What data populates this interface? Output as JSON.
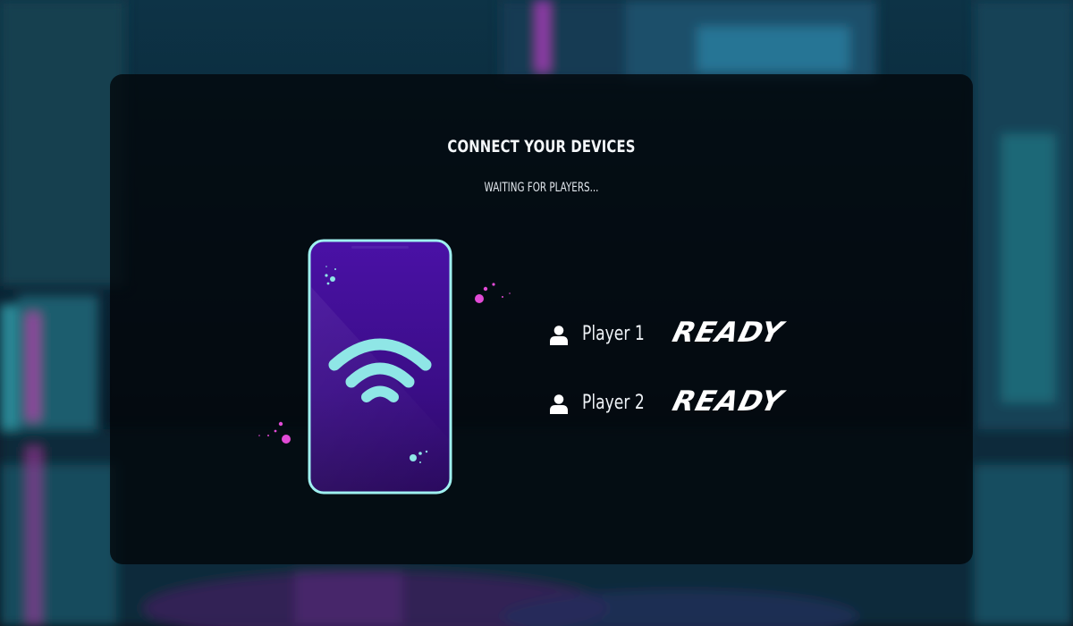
{
  "screen": {
    "title": "CONNECT YOUR DEVICES",
    "subtitle": "WAITING FOR PLAYERS..."
  },
  "players": [
    {
      "name": "Player 1",
      "status": "READY",
      "icon": "user-icon"
    },
    {
      "name": "Player 2",
      "status": "READY",
      "icon": "user-icon"
    }
  ],
  "illustration": {
    "device": "smartphone",
    "icon": "wifi-icon"
  },
  "colors": {
    "accent_cyan": "#8fe6e6",
    "phone_purple": "#3f0f8a",
    "sparkle_pink": "#e24bd6",
    "panel_overlay": "#02060a"
  }
}
